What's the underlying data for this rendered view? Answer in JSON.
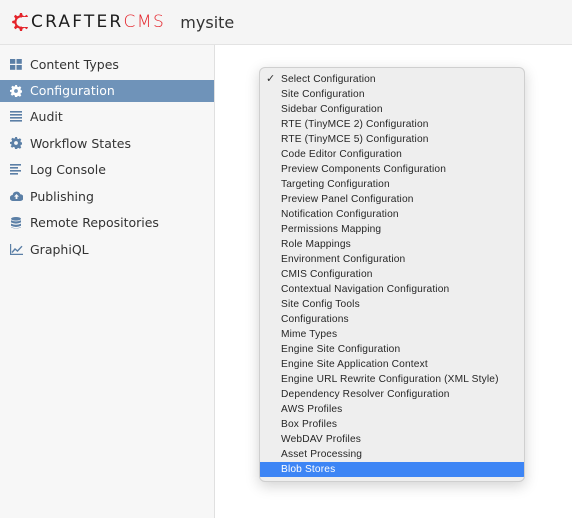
{
  "header": {
    "logo_dark": "CRAFTER",
    "logo_red": "CMS",
    "site_name": "mysite"
  },
  "colors": {
    "brand_red": "#e4242b",
    "sidebar_active": "#6f93b9",
    "icon_blue": "#5b7fa6",
    "option_highlight": "#3d85f5"
  },
  "sidebar": {
    "items": [
      {
        "label": "Content Types",
        "icon": "grid-icon",
        "active": false
      },
      {
        "label": "Configuration",
        "icon": "gear-icon",
        "active": true
      },
      {
        "label": "Audit",
        "icon": "list-icon",
        "active": false
      },
      {
        "label": "Workflow States",
        "icon": "gear-icon",
        "active": false
      },
      {
        "label": "Log Console",
        "icon": "align-left-icon",
        "active": false
      },
      {
        "label": "Publishing",
        "icon": "cloud-upload-icon",
        "active": false
      },
      {
        "label": "Remote Repositories",
        "icon": "database-icon",
        "active": false
      },
      {
        "label": "GraphiQL",
        "icon": "line-chart-icon",
        "active": false
      }
    ]
  },
  "config_select": {
    "selected": "Select Configuration",
    "highlighted": "Blob Stores",
    "options": [
      "Select Configuration",
      "Site Configuration",
      "Sidebar Configuration",
      "RTE (TinyMCE 2) Configuration",
      "RTE (TinyMCE 5) Configuration",
      "Code Editor Configuration",
      "Preview Components Configuration",
      "Targeting Configuration",
      "Preview Panel Configuration",
      "Notification Configuration",
      "Permissions Mapping",
      "Role Mappings",
      "Environment Configuration",
      "CMIS Configuration",
      "Contextual Navigation Configuration",
      "Site Config Tools",
      "Configurations",
      "Mime Types",
      "Engine Site Configuration",
      "Engine Site Application Context",
      "Engine URL Rewrite Configuration (XML Style)",
      "Dependency Resolver Configuration",
      "AWS Profiles",
      "Box Profiles",
      "WebDAV Profiles",
      "Asset Processing",
      "Blob Stores"
    ],
    "check_glyph": "✓"
  }
}
